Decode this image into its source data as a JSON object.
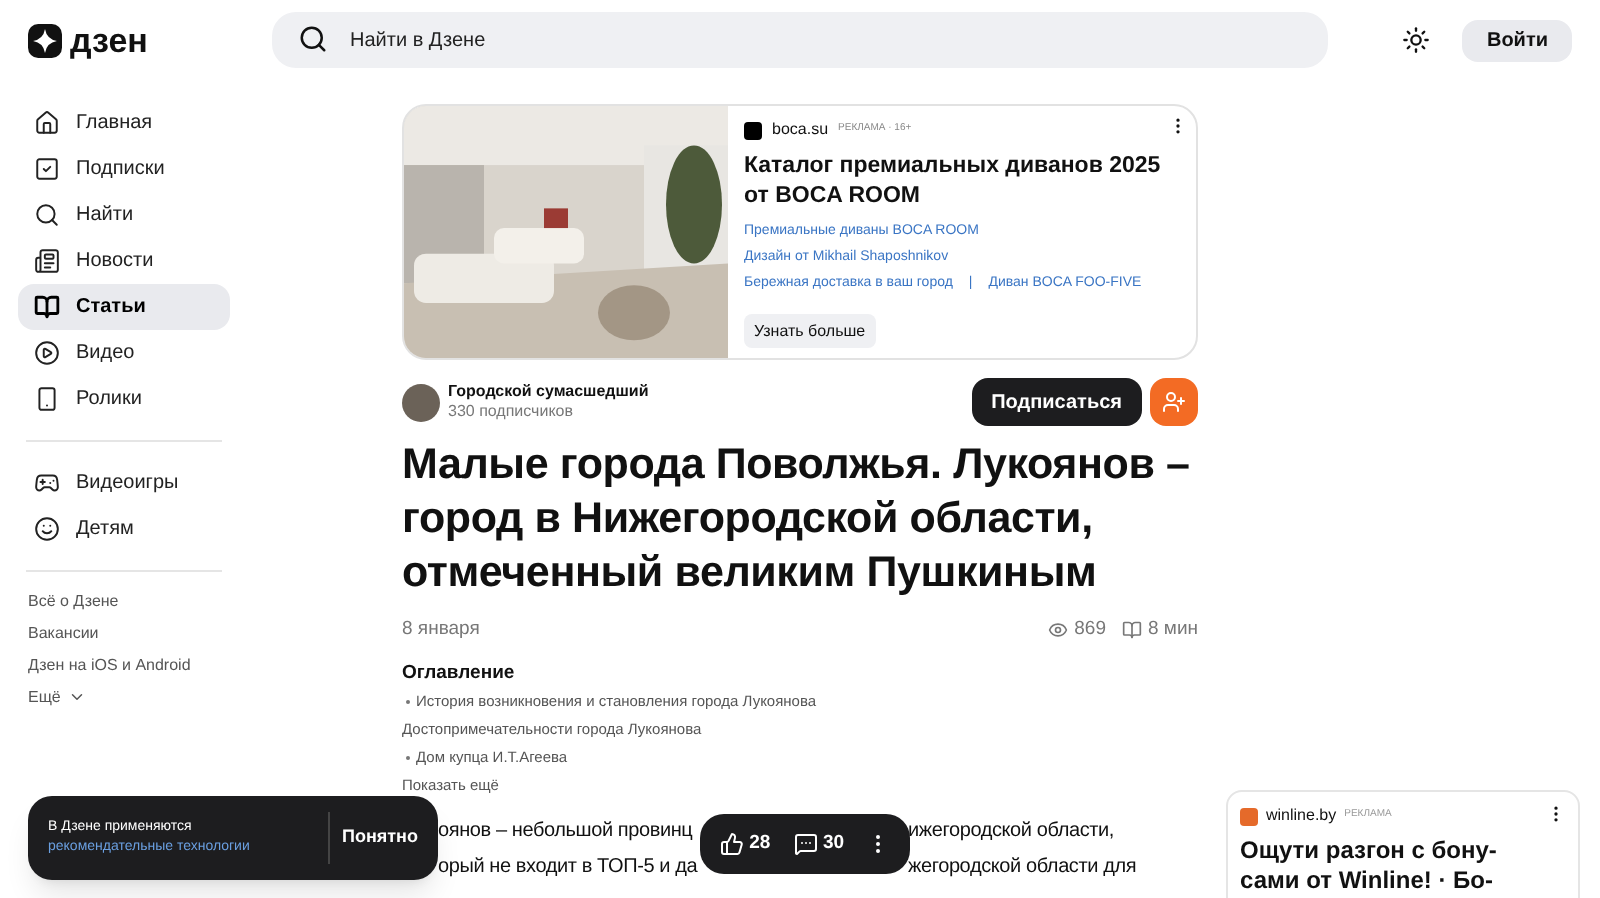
{
  "header": {
    "logo": "дзен",
    "search": {
      "placeholder": "Найти в Дзене"
    },
    "login": "Войти"
  },
  "sidebar": {
    "items": [
      {
        "label": "Главная",
        "selected": false
      },
      {
        "label": "Подписки",
        "selected": false
      },
      {
        "label": "Найти",
        "selected": false
      },
      {
        "label": "Новости",
        "selected": false
      },
      {
        "label": "Статьи",
        "selected": true
      },
      {
        "label": "Видео",
        "selected": false
      },
      {
        "label": "Ролики",
        "selected": false
      }
    ],
    "extra_items": [
      {
        "label": "Видеоигры",
        "selected": false
      },
      {
        "label": "Детям",
        "selected": false
      }
    ],
    "links": [
      "Всё о Дзене",
      "Вакансии",
      "Дзен на iOS и Android"
    ],
    "more": "Ещё"
  },
  "ad": {
    "kind": "picture",
    "domain": "boca.su",
    "label": "РЕКЛАМА · 16+",
    "title": "Каталог премиальных диванов 2025 от BOCA ROOM",
    "links": [
      "Премиальные диваны BOCA ROOM",
      "Дизайн от Mikhail Shaposhnikov",
      "Бережная доставка в ваш город",
      "Диван BOCA FOO-FIVE"
    ],
    "separator": "|",
    "button": "Узнать больше"
  },
  "author": {
    "name": "Городской сумасшедший",
    "subscribers": "330 подписчиков",
    "subscribe": "Подписаться"
  },
  "article": {
    "title": "Малые города Поволжья. Лукоянов – город в Нижегородской области, отмеченный великим Пушкиным",
    "date": "8 января",
    "views": "869",
    "read_time": "8 мин",
    "toc": {
      "heading": "Оглавление",
      "items": [
        {
          "text": "История возникновения и становления города Лукоянова",
          "kind": "sub"
        },
        {
          "text": "Достопримечательности города Лукоянова",
          "kind": "top"
        },
        {
          "text": "Дом купца И.Т.Агеева",
          "kind": "sub"
        }
      ],
      "show_more": "Показать ещё"
    },
    "body_lines": [
      {
        "left": "оянов – небольшой провинц",
        "right": "ижегородской области,"
      },
      {
        "left": "орый не входит в ТОП-5 и да",
        "right": "жегородской области для"
      }
    ]
  },
  "reactions": {
    "likes": "28",
    "comments": "30"
  },
  "cookie": {
    "text": "В Дзене применяются",
    "link": "рекомендательные технологии",
    "button": "Понятно"
  },
  "side_ad": {
    "domain": "winline.by",
    "label": "РЕКЛАМА",
    "title_lines": [
      "Ощути разгон с бону-",
      "сами от Winline! · Бо-"
    ]
  }
}
